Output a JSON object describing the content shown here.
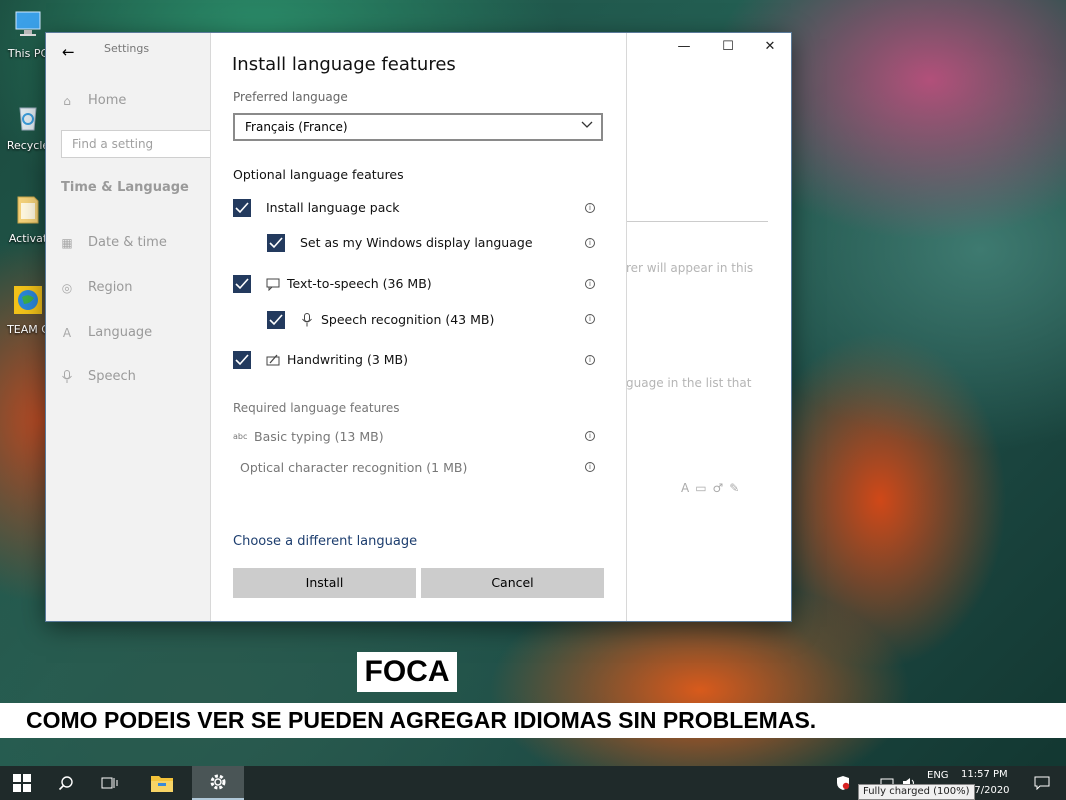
{
  "desktop": {
    "icons": [
      {
        "label": "This PC",
        "icon": "computer-icon"
      },
      {
        "label": "Recycle",
        "icon": "recycle-bin-icon"
      },
      {
        "label": "Activat",
        "icon": "folder-icon"
      },
      {
        "label": "TEAM C",
        "icon": "globe-icon"
      }
    ]
  },
  "settings": {
    "app_title": "Settings",
    "home": "Home",
    "search_placeholder": "Find a setting",
    "section": "Time & Language",
    "nav": [
      {
        "label": "Date & time",
        "icon": "calendar-icon"
      },
      {
        "label": "Region",
        "icon": "globe-icon"
      },
      {
        "label": "Language",
        "icon": "language-icon"
      },
      {
        "label": "Speech",
        "icon": "microphone-icon"
      }
    ],
    "background_text": [
      "rer will appear in this",
      "guage in the list that"
    ]
  },
  "dialog": {
    "title": "Install language features",
    "preferred_label": "Preferred language",
    "preferred_value": "Français (France)",
    "optional_title": "Optional language features",
    "options": [
      {
        "label": "Install language pack",
        "checked": true
      },
      {
        "label": "Set as my Windows display language",
        "checked": true
      },
      {
        "label": "Text-to-speech (36 MB)",
        "checked": true,
        "icon": "speech-icon"
      },
      {
        "label": "Speech recognition (43 MB)",
        "checked": true,
        "icon": "microphone-icon"
      },
      {
        "label": "Handwriting (3 MB)",
        "checked": true,
        "icon": "handwriting-icon"
      }
    ],
    "required_title": "Required language features",
    "required": [
      {
        "label": "Basic typing (13 MB)",
        "icon": "typing-icon"
      },
      {
        "label": "Optical character recognition (1 MB)",
        "icon": "ocr-icon"
      }
    ],
    "choose_link": "Choose a different language",
    "install_button": "Install",
    "cancel_button": "Cancel"
  },
  "captions": {
    "foca": "FOCA",
    "main": "COMO PODEIS VER SE PUEDEN AGREGAR IDIOMAS SIN PROBLEMAS."
  },
  "taskbar": {
    "lang": "ENG",
    "time": "11:57 PM",
    "date": "27/2020",
    "battery_tooltip": "Fully charged (100%)"
  },
  "colors": {
    "checkbox": "#233a5e",
    "link": "#1c3d6e",
    "button": "#cccccc"
  }
}
